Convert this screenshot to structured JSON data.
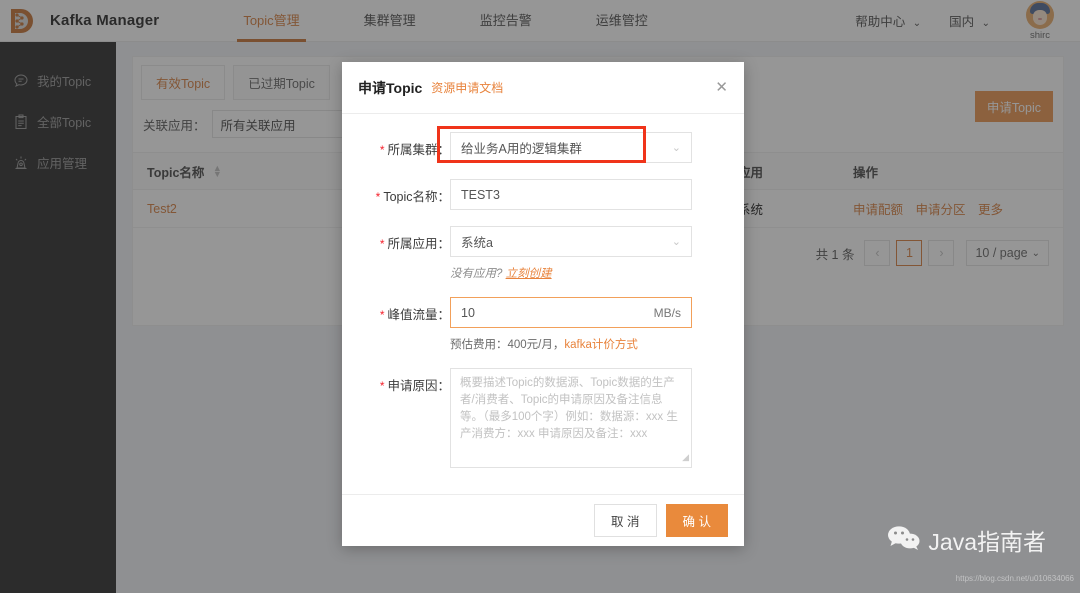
{
  "header": {
    "brand": "Kafka Manager",
    "logo_icon": "kafka-d-logo-icon",
    "nav": [
      {
        "label": "Topic管理",
        "active": true
      },
      {
        "label": "集群管理",
        "active": false
      },
      {
        "label": "监控告警",
        "active": false
      },
      {
        "label": "运维管控",
        "active": false
      }
    ],
    "help_center": "帮助中心",
    "region": "国内",
    "username": "shirc"
  },
  "sidebar": {
    "items": [
      {
        "label": "我的Topic",
        "icon": "message-icon"
      },
      {
        "label": "全部Topic",
        "icon": "clipboard-icon"
      },
      {
        "label": "应用管理",
        "icon": "app-manage-icon"
      }
    ]
  },
  "main": {
    "tabs": [
      {
        "label": "有效Topic",
        "active": true
      },
      {
        "label": "已过期Topic",
        "active": false
      }
    ],
    "filter": {
      "label": "关联应用：",
      "value": "所有关联应用"
    },
    "apply_button": "申请Topic",
    "table": {
      "columns": [
        "Topic名称",
        "关联应用",
        "操作"
      ],
      "rows": [
        {
          "name": "Test2",
          "app": "订单系统",
          "ops": [
            "申请配额",
            "申请分区",
            "更多"
          ]
        }
      ]
    },
    "pagination": {
      "total": "共 1 条",
      "prev": "‹",
      "current": "1",
      "next": "›",
      "page_size": "10 / page"
    }
  },
  "modal": {
    "title": "申请Topic",
    "doc_link": "资源申请文档",
    "close_icon": "close-icon",
    "fields": {
      "cluster": {
        "label": "所属集群：",
        "value": "给业务A用的逻辑集群",
        "type": "select"
      },
      "topic_name": {
        "label": "Topic名称：",
        "value": "TEST3",
        "type": "input"
      },
      "app": {
        "label": "所属应用：",
        "value": "系统a",
        "type": "select",
        "hint_prefix": "没有应用? ",
        "hint_link": "立刻创建"
      },
      "peak_flow": {
        "label": "峰值流量：",
        "value": "10",
        "unit": "MB/s",
        "type": "input",
        "note_prefix": "预估费用：400元/月，",
        "note_link": "kafka计价方式"
      },
      "reason": {
        "label": "申请原因：",
        "value": "",
        "placeholder": "概要描述Topic的数据源、Topic数据的生产者/消费者、Topic的申请原因及备注信息等。（最多100个字）例如：数据源：xxx 生产消费方：xxx 申请原因及备注：xxx",
        "type": "textarea"
      }
    },
    "cancel": "取 消",
    "confirm": "确 认"
  },
  "annotation": {
    "color": "#f0341a",
    "target": "所属集群"
  },
  "watermark": {
    "text": "Java指南者",
    "icon": "wechat-icon",
    "url": "https://blog.csdn.net/u010634066"
  },
  "colors": {
    "accent": "#e98a3c",
    "brand_dark": "#141414",
    "required": "#f5222d"
  }
}
